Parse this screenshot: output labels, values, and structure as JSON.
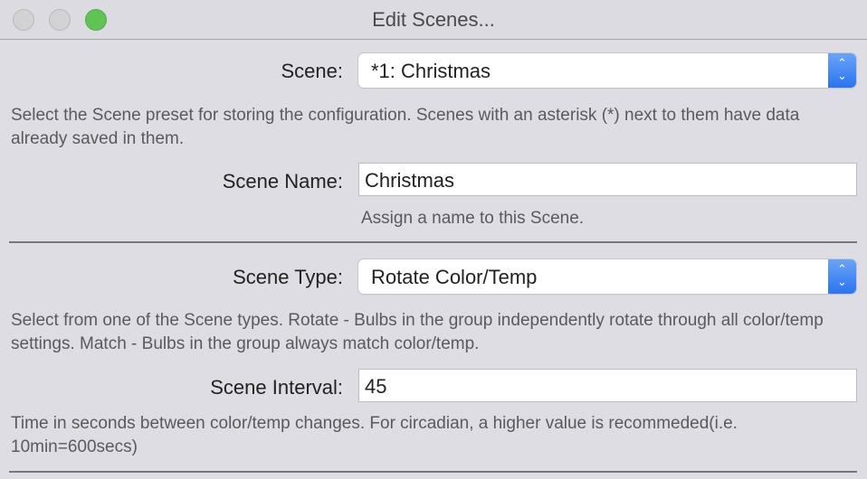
{
  "window": {
    "title": "Edit Scenes..."
  },
  "scene": {
    "label": "Scene:",
    "value": "*1: Christmas",
    "description": "Select the Scene preset for storing the configuration. Scenes with an asterisk (*) next to them have data already saved in them."
  },
  "scene_name": {
    "label": "Scene Name:",
    "value": "Christmas",
    "description": "Assign a name to this Scene."
  },
  "scene_type": {
    "label": "Scene Type:",
    "value": "Rotate Color/Temp",
    "description": "Select from one of the Scene types. Rotate - Bulbs in the group independently rotate through all color/temp settings. Match - Bulbs in the group always match color/temp."
  },
  "scene_interval": {
    "label": "Scene Interval:",
    "value": "45",
    "description": "Time in seconds between color/temp changes. For circadian, a higher value is recommeded(i.e. 10min=600secs)"
  },
  "colors": {
    "accent": "#2b74f0",
    "zoom_button": "#5fc454"
  }
}
